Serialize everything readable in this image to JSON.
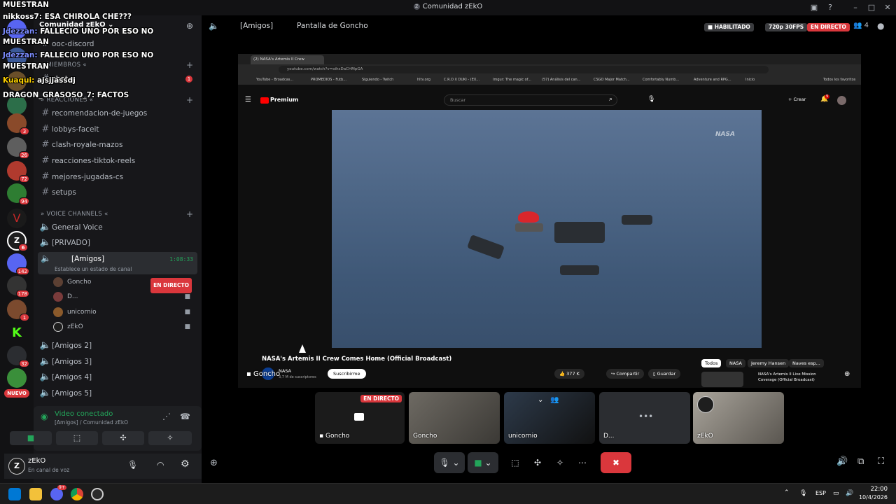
{
  "window": {
    "title": "Comunidad zEkO"
  },
  "overlay_chat": [
    {
      "user": "MUESTRAN",
      "text": ""
    },
    {
      "user": "nikkoss7:",
      "text": "ESA CHIROLA CHE???"
    },
    {
      "user": "Jdezzan:",
      "text": "FALLECIO UNO POR ESO NO"
    },
    {
      "user": "MUESTRAN",
      "text": ""
    },
    {
      "user": "Jdezzan:",
      "text": "FALLECIO UNO POR ESO NO"
    },
    {
      "user": "MUESTRAN",
      "text": ""
    },
    {
      "user": "Kuaqui:",
      "text": "ajsjjassdj"
    },
    {
      "user": "DRAGON_GRASOSO_7:",
      "text": "FACTOS"
    }
  ],
  "server": {
    "name": "Comunidad zEkO"
  },
  "channels": {
    "ooc": "ooc-discord",
    "miembros_cat": "MIEMBROS",
    "chat": "chat",
    "chat_badge": "1",
    "reacciones_cat": "REACCIONES",
    "text_channels": [
      "recomendacion-de-juegos",
      "lobbys-faceit",
      "clash-royale-mazos",
      "reacciones-tiktok-reels",
      "mejores-jugadas-cs",
      "setups"
    ],
    "voice_cat": "VOICE CHANNELS",
    "voice": {
      "general": "General Voice",
      "privado": "[PRIVADO]",
      "amigos": "[Amigos]",
      "amigos_timer": "1:08:33",
      "amigos_status": "Establece un estado de canal",
      "amigos2": "[Amigos 2]",
      "amigos3": "[Amigos 3]",
      "amigos4": "[Amigos 4]",
      "amigos5": "[Amigos 5]"
    },
    "members": [
      {
        "name": "Goncho",
        "live": "EN DIRECTO"
      },
      {
        "name": "D..."
      },
      {
        "name": "unicornio"
      },
      {
        "name": "zEkO"
      }
    ]
  },
  "server_badges": [
    "3",
    "26",
    "72",
    "94",
    "6",
    "142",
    "178",
    "1",
    "32"
  ],
  "nuevo_label": "NUEVO",
  "voice_panel": {
    "status": "Video conectado",
    "location": "[Amigos] / Comunidad zEkO"
  },
  "user_panel": {
    "name": "zEkO",
    "status": "En canal de voz"
  },
  "header": {
    "channel": "[Amigos]",
    "stream": "Pantalla de Goncho",
    "enabled": "HABILITADO",
    "quality": "720p 30FPS",
    "live": "EN DIRECTO",
    "viewers": "4"
  },
  "browser": {
    "tab": "(2) NASA's Artemis II Crew",
    "url": "youtube.com/watch?v=oihsDaCHMpGA",
    "bookmarks": [
      "YouTube - Broadcas...",
      "PROMEDIOS - Futb...",
      "Siguiendo - Twitch",
      "hltv.org",
      "C.R.O X DUKI - (EX...",
      "Imgur: The magic of...",
      "(57) Análisis del can...",
      "CSGO Major Match...",
      "Comfortably Numb...",
      "Adventure and RPG...",
      "Inicio"
    ],
    "all_bookmarks": "Todos los favoritos",
    "search_placeholder": "Buscar",
    "premium": "Premium",
    "create": "Crear",
    "notif_count": "9",
    "watermark": "NASA",
    "video_title": "NASA's Artemis II Crew Comes Home (Official Broadcast)",
    "channel": "NASA",
    "subs": "3,7 M de suscriptores",
    "subscribe": "Suscribirme",
    "likes": "377 K",
    "share": "Compartir",
    "save": "Guardar",
    "chips": [
      "Todos",
      "NASA",
      "Jeremy Hansen",
      "Naves esp..."
    ],
    "rec_title": "NASA's Artemis II Live Mission Coverage (Official Broadcast)",
    "cursor_label": "Goncho"
  },
  "tiles": [
    {
      "name": "Goncho",
      "live": "EN DIRECTO"
    },
    {
      "name": "Goncho"
    },
    {
      "name": "unicornio"
    },
    {
      "name": "D..."
    },
    {
      "name": "zEkO"
    }
  ],
  "taskbar": {
    "lang": "ESP",
    "time": "22:00",
    "date": "10/4/2026",
    "discord_badge": "9+"
  }
}
